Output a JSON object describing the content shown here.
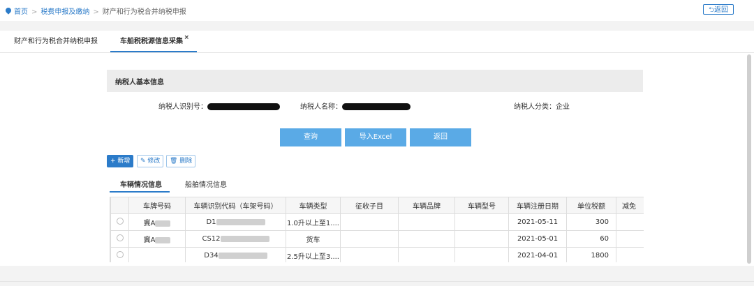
{
  "breadcrumb": {
    "home": "首页",
    "level1": "税费申报及缴纳",
    "level2": "财产和行为税合并纳税申报",
    "separator": ">"
  },
  "top_return_button": "返回",
  "tabs": [
    {
      "label": "财产和行为税合并纳税申报"
    },
    {
      "label": "车船税税源信息采集",
      "close": "×"
    }
  ],
  "taxpayer_section": {
    "title": "纳税人基本信息",
    "id_label": "纳税人识别号：",
    "name_label": "纳税人名称：",
    "category_label": "纳税人分类：",
    "category_value": "企业"
  },
  "actions": {
    "query": "查询",
    "import_excel": "导入Excel",
    "back": "返回"
  },
  "toolbar": {
    "add": "+ 新增",
    "edit": "修改",
    "delete": "删除"
  },
  "subtabs": [
    {
      "label": "车辆情况信息"
    },
    {
      "label": "船舶情况信息"
    }
  ],
  "table": {
    "columns": [
      "车牌号码",
      "车辆识别代码（车架号码）",
      "车辆类型",
      "征收子目",
      "车辆品牌",
      "车辆型号",
      "车辆注册日期",
      "单位税额",
      "减免"
    ],
    "rows": [
      {
        "plate": "冀A",
        "vin": "D1",
        "type": "1.0升以上至1....",
        "sub": "",
        "brand": "",
        "model": "",
        "date": "2021-05-11",
        "tax": "300"
      },
      {
        "plate": "冀A",
        "vin": "CS12",
        "type": "货车",
        "sub": "",
        "brand": "",
        "model": "",
        "date": "2021-05-01",
        "tax": "60"
      },
      {
        "plate": "",
        "vin": "D34",
        "type": "2.5升以上至3....",
        "sub": "",
        "brand": "",
        "model": "",
        "date": "2021-04-01",
        "tax": "1800"
      }
    ]
  },
  "colors": {
    "accent": "#2b7bc9",
    "action_button": "#5aaae6"
  }
}
